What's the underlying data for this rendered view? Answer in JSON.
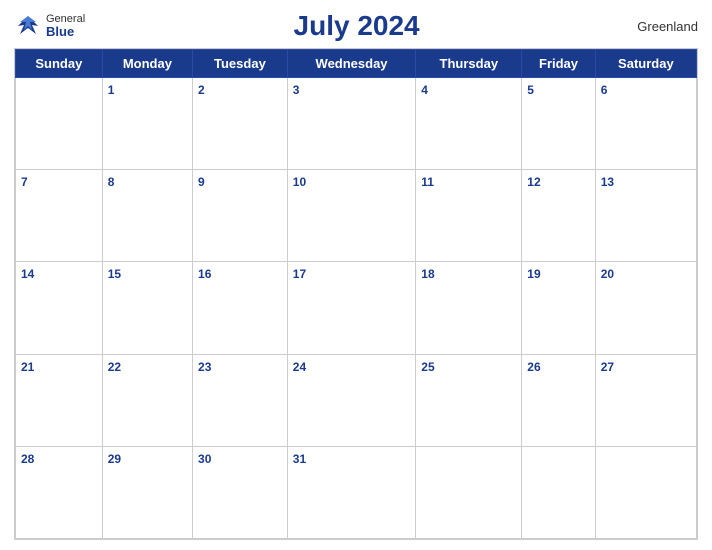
{
  "header": {
    "logo_general": "General",
    "logo_blue": "Blue",
    "title": "July 2024",
    "region": "Greenland"
  },
  "days_of_week": [
    "Sunday",
    "Monday",
    "Tuesday",
    "Wednesday",
    "Thursday",
    "Friday",
    "Saturday"
  ],
  "weeks": [
    [
      null,
      1,
      2,
      3,
      4,
      5,
      6
    ],
    [
      7,
      8,
      9,
      10,
      11,
      12,
      13
    ],
    [
      14,
      15,
      16,
      17,
      18,
      19,
      20
    ],
    [
      21,
      22,
      23,
      24,
      25,
      26,
      27
    ],
    [
      28,
      29,
      30,
      31,
      null,
      null,
      null
    ]
  ]
}
